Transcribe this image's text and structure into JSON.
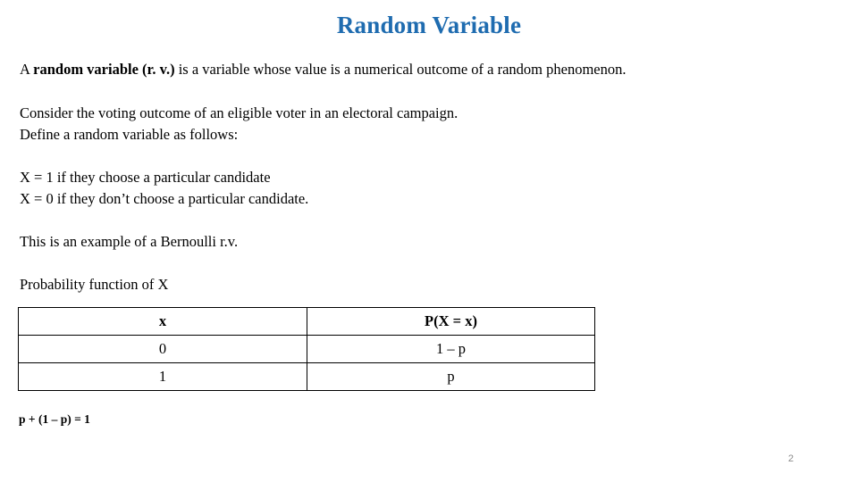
{
  "slide": {
    "title": "Random Variable",
    "title_color": "#1F6CB0",
    "background_color": "#FFFFFF",
    "page_number": "2"
  },
  "paragraphs": {
    "definition": {
      "lead": "A ",
      "bold_term": "random variable (r. v.)",
      "rest": " is a variable whose value is a numerical outcome of a random phenomenon."
    },
    "consider": {
      "line1": "Consider the voting outcome of an eligible voter in an electoral campaign.",
      "line2": "Define a random variable as follows:"
    },
    "x_values": {
      "line1": "X = 1 if they choose a particular candidate",
      "line2": "X = 0 if they don’t choose a particular candidate."
    },
    "bernoulli": "This is an example of a Bernoulli r.v.",
    "pf_label": "Probability function of X"
  },
  "table": {
    "headers": [
      "x",
      "P(X = x)"
    ],
    "rows": [
      [
        "0",
        "1 – p"
      ],
      [
        "1",
        "p"
      ]
    ]
  },
  "footer": {
    "formula": "p + (1 – p) = 1"
  }
}
